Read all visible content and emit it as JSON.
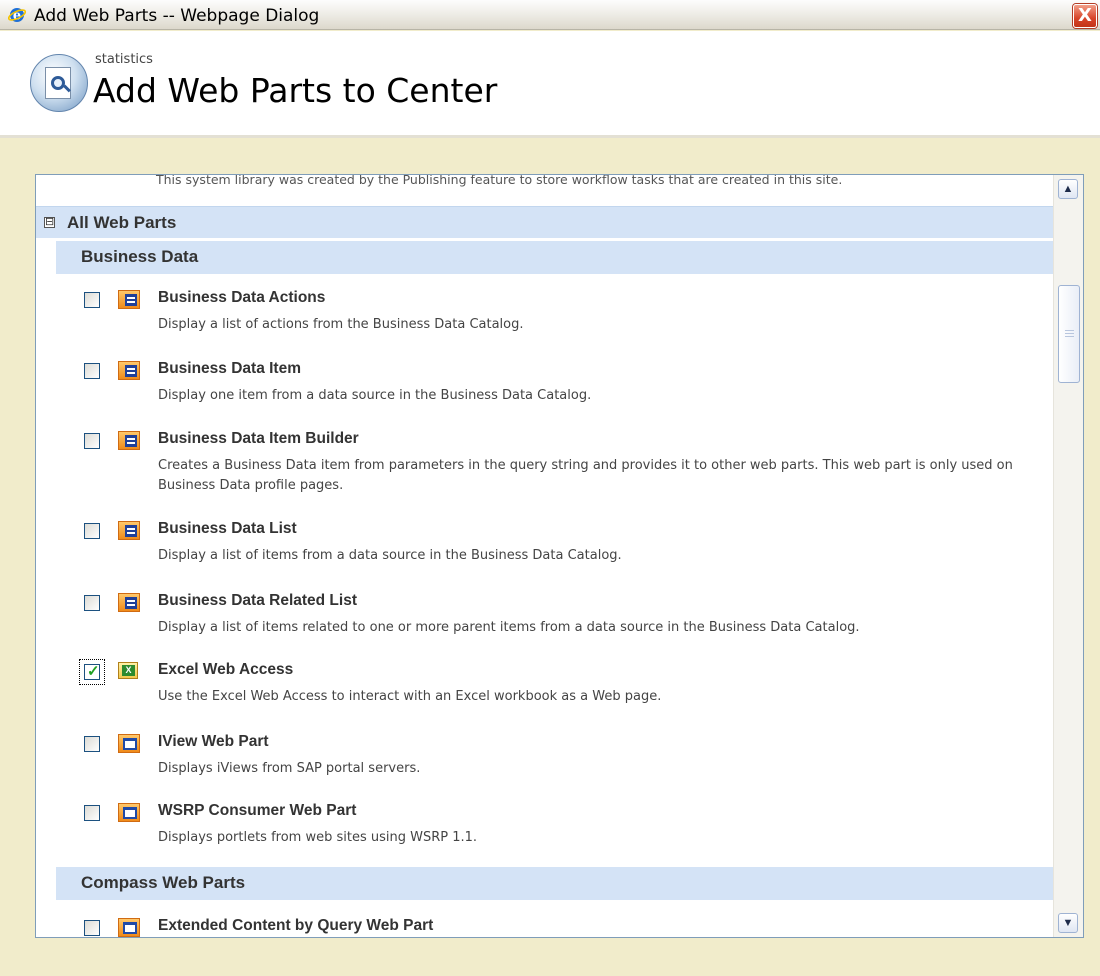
{
  "window": {
    "title": "Add Web Parts -- Webpage Dialog",
    "close_label": "X"
  },
  "header": {
    "subtitle": "statistics",
    "title": "Add Web Parts to Center"
  },
  "list": {
    "cut_text": "This system library was created by the Publishing feature to store workflow tasks that are created in this site.",
    "group": {
      "toggle": "⊟",
      "label": "All Web Parts"
    },
    "categories": [
      {
        "label": "Business Data",
        "items": [
          {
            "title": "Business Data Actions",
            "desc": "Display a list of actions from the Business Data Catalog.",
            "checked": false,
            "icon": "web-part-icon"
          },
          {
            "title": "Business Data Item",
            "desc": "Display one item from a data source in the Business Data Catalog.",
            "checked": false,
            "icon": "web-part-icon"
          },
          {
            "title": "Business Data Item Builder",
            "desc": "Creates a Business Data item from parameters in the query string and provides it to other web parts. This web part is only used on Business Data profile pages.",
            "checked": false,
            "icon": "web-part-icon"
          },
          {
            "title": "Business Data List",
            "desc": "Display a list of items from a data source in the Business Data Catalog.",
            "checked": false,
            "icon": "web-part-icon"
          },
          {
            "title": "Business Data Related List",
            "desc": "Display a list of items related to one or more parent items from a data source in the Business Data Catalog.",
            "checked": false,
            "icon": "web-part-icon"
          },
          {
            "title": "Excel Web Access",
            "desc": "Use the Excel Web Access to interact with an Excel workbook as a Web page.",
            "checked": true,
            "icon": "excel-icon"
          },
          {
            "title": "IView Web Part",
            "desc": "Displays iViews from SAP portal servers.",
            "checked": false,
            "icon": "window-icon"
          },
          {
            "title": "WSRP Consumer Web Part",
            "desc": "Displays portlets from web sites using WSRP 1.1.",
            "checked": false,
            "icon": "window-icon"
          }
        ]
      },
      {
        "label": "Compass Web Parts",
        "items": [
          {
            "title": "Extended Content by Query Web Part",
            "desc": "",
            "checked": false,
            "icon": "window-icon"
          }
        ]
      }
    ]
  },
  "scrollbar": {
    "up": "▲",
    "down": "▼",
    "position": 0.2
  }
}
